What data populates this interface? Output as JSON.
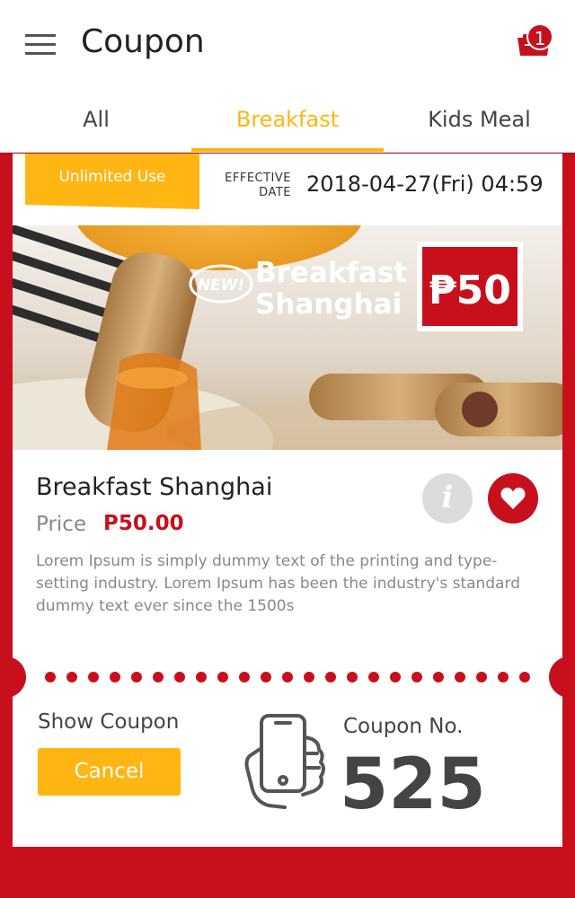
{
  "header": {
    "title": "Coupon",
    "cart_count": "1"
  },
  "tabs": [
    {
      "label": "All",
      "active": false
    },
    {
      "label": "Breakfast",
      "active": true
    },
    {
      "label": "Kids Meal",
      "active": false
    }
  ],
  "coupon": {
    "ribbon_label": "Unlimited Use",
    "effective_label_line1": "EFFECTIVE",
    "effective_label_line2": "DATE",
    "effective_date": "2018-04-27(Fri) 04:59",
    "banner": {
      "badge": "NEW!",
      "title_line1": "Breakfast",
      "title_line2": "Shanghai",
      "price_tag": "₱50"
    },
    "item_name": "Breakfast Shanghai",
    "price_label": "Price",
    "price_value": "P50.00",
    "description": "Lorem Ipsum is simply dummy text of the printing and type-setting industry. Lorem Ipsum has been the industry's standard dummy text ever since the 1500s",
    "show_coupon_label": "Show Coupon",
    "cancel_label": "Cancel",
    "coupon_no_label": "Coupon No.",
    "coupon_number": "525"
  },
  "colors": {
    "brand_red": "#c8101c",
    "accent_yellow": "#ffb612"
  }
}
